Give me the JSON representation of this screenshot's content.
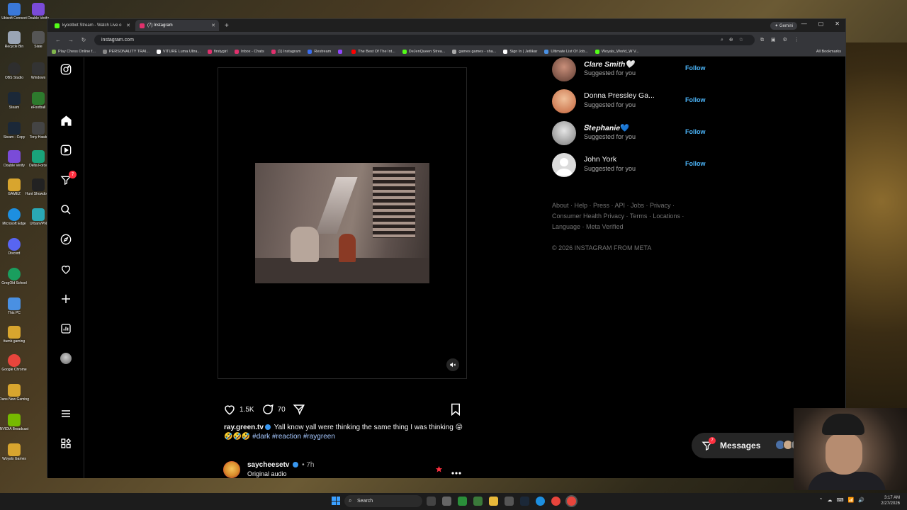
{
  "browser": {
    "tabs": [
      {
        "label": "kyootbot Stream - Watch Live o",
        "color": "#53fc18",
        "active": false
      },
      {
        "label": "(7) Instagram",
        "color": "#e1306c",
        "active": true
      }
    ],
    "new_tab": "+",
    "gemini_label": "Gemini",
    "url": "instagram.com",
    "bookmarks": [
      {
        "label": "Play Chess Online f...",
        "color": "#81b64c"
      },
      {
        "label": "PERSONALITY TRAI...",
        "color": "#888888"
      },
      {
        "label": "VITURE Luma Ultra...",
        "color": "#ffffff"
      },
      {
        "label": "firstygirl",
        "color": "#e1306c"
      },
      {
        "label": "Inbox - Chats",
        "color": "#e1306c"
      },
      {
        "label": "(1) Instagram",
        "color": "#e1306c"
      },
      {
        "label": "Restream",
        "color": "#3a6df0"
      },
      {
        "label": "",
        "color": "#9146ff"
      },
      {
        "label": "The Best Of The Int...",
        "color": "#ff0000"
      },
      {
        "label": "DeJenQueen Strea...",
        "color": "#53fc18"
      },
      {
        "label": "games games - sha...",
        "color": "#aaaaaa"
      },
      {
        "label": "Sign In | Jetlikar",
        "color": "#ffffff"
      },
      {
        "label": "Ultimate List Of Job...",
        "color": "#4a90e2"
      },
      {
        "label": "Woyals_World_W V...",
        "color": "#53fc18"
      }
    ],
    "all_bookmarks": "All Bookmarks"
  },
  "sidebar": {
    "notification_count": "7"
  },
  "post": {
    "likes": "1.5K",
    "comments": "70",
    "username": "ray.green.tv",
    "caption": "Yall know yall were thinking the same thing I was thinking 😝🤣🤣🤣",
    "hashtags": "#dark #reaction #raygreen"
  },
  "next_post": {
    "username": "saycheesetv",
    "time": "• 7h",
    "audio": "Original audio"
  },
  "suggestions": [
    {
      "name": "Clare Smith🤍",
      "sub": "Suggested for you",
      "follow": "Follow",
      "avatar_color": "#5b3a30"
    },
    {
      "name": "Donna Pressley Ga...",
      "sub": "Suggested for you",
      "follow": "Follow",
      "avatar_color": "#c2623a"
    },
    {
      "name": "𝑺𝒕𝒆𝒑𝒉𝒂𝒏𝒊𝒆💙",
      "sub": "Suggested for you",
      "follow": "Follow",
      "avatar_color": "#9a9a9a"
    },
    {
      "name": "John York",
      "sub": "Suggested for you",
      "follow": "Follow",
      "avatar_color": "#dbdbdb"
    }
  ],
  "footer": {
    "links_line1": "About · Help · Press · API · Jobs · Privacy ·",
    "links_line2": "Consumer Health Privacy · Terms · Locations ·",
    "links_line3": "Language · Meta Verified",
    "copyright": "© 2026 INSTAGRAM FROM META"
  },
  "messages": {
    "label": "Messages",
    "count": "7"
  },
  "taskbar": {
    "search": "Search",
    "time": "3:17 AM",
    "date": "2/27/2026"
  },
  "colors": {
    "accent": "#4cb5f9",
    "badge": "#ff3040"
  }
}
